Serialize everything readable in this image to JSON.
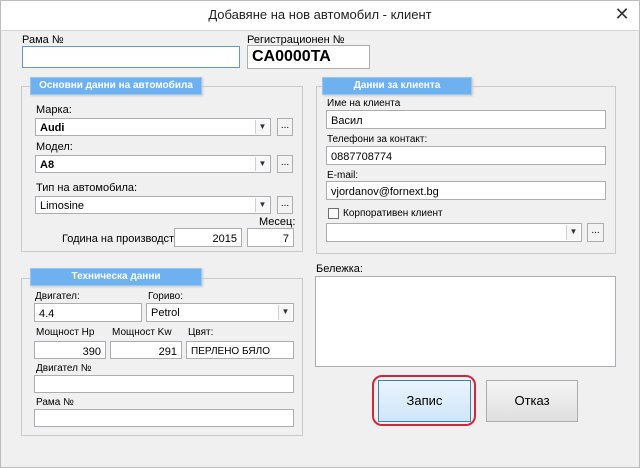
{
  "window": {
    "title": "Добавяне на нов автомобил - клиент",
    "close_glyph": "✕"
  },
  "frame": {
    "label": "Рама №",
    "value": ""
  },
  "reg": {
    "label": "Регистрационен №",
    "value": "CA0000TA"
  },
  "car": {
    "header": "Основни данни на автомобила",
    "make_label": "Марка:",
    "make_value": "Audi",
    "model_label": "Модел:",
    "model_value": "A8",
    "type_label": "Тип на автомобила:",
    "type_value": "Limosine",
    "year_label": "Година на производство:",
    "year_value": "2015",
    "month_label": "Месец:",
    "month_value": "7"
  },
  "client": {
    "header": "Данни за клиента",
    "name_label": "Име на клиента",
    "name_value": "Васил",
    "phone_label": "Телефони за контакт:",
    "phone_value": "0887708774",
    "email_label": "E-mail:",
    "email_value": "vjordanov@fornext.bg",
    "corporate_label": "Корпоративен клиент",
    "company_value": ""
  },
  "tech": {
    "header": "Техническа данни",
    "engine_label": "Двигател:",
    "engine_value": "4.4",
    "fuel_label": "Гориво:",
    "fuel_value": "Petrol",
    "hp_label": "Мощност Hp",
    "hp_value": "390",
    "kw_label": "Мощност Kw",
    "kw_value": "291",
    "color_label": "Цвят:",
    "color_value": "ПЕРЛЕНО БЯЛО",
    "engine_no_label": "Двигател №",
    "engine_no_value": "",
    "frame_no_label": "Рама №",
    "frame_no_value": ""
  },
  "note": {
    "label": "Бележка:",
    "value": ""
  },
  "buttons": {
    "save": "Запис",
    "cancel": "Отказ",
    "more": "..."
  },
  "icons": {
    "dropdown": "chevron-down-icon",
    "close": "close-icon",
    "checkbox": "checkbox-icon"
  },
  "colors": {
    "group_header": "#6eb1f0",
    "highlight_ring": "#d0283a",
    "focus_border": "#5e9bd4"
  }
}
